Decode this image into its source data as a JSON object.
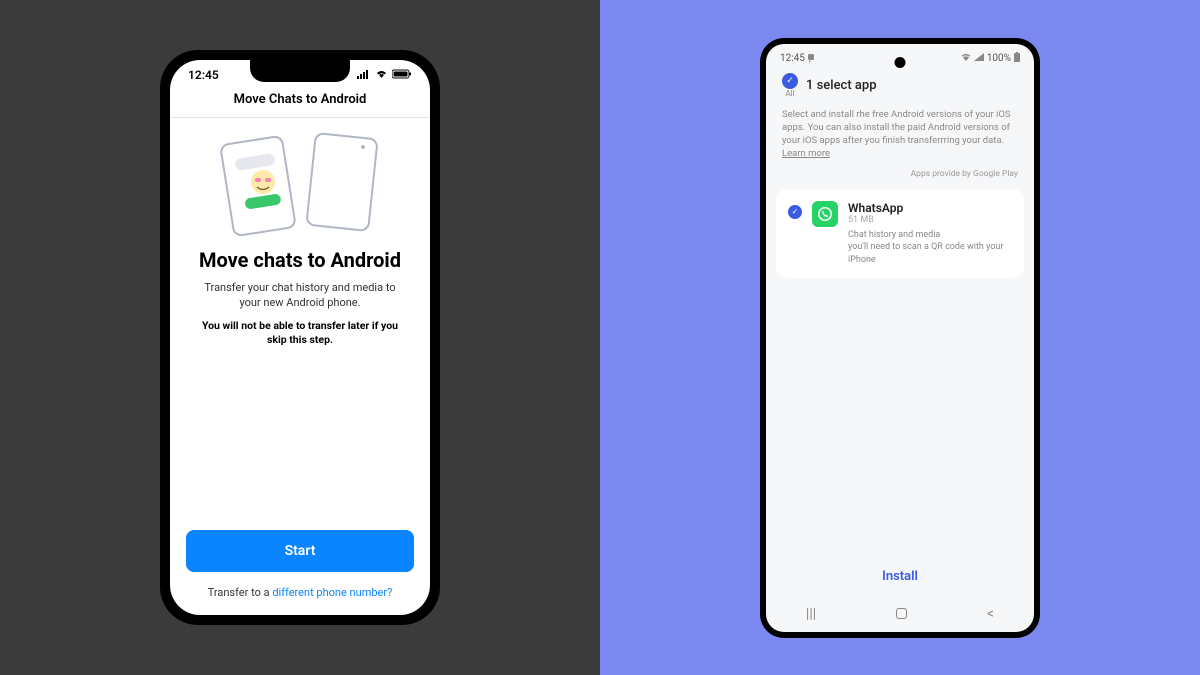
{
  "iphone": {
    "statusbar": {
      "time": "12:45"
    },
    "headerTitle": "Move Chats to Android",
    "mainTitle": "Move chats to Android",
    "description": "Transfer your chat history and media to your new Android phone.",
    "warning": "You will not be able to transfer later if you skip this step.",
    "startButton": "Start",
    "transferPrefix": "Transfer to a ",
    "transferLink": "different phone number?"
  },
  "android": {
    "statusbar": {
      "time": "12:45",
      "battery": "100%"
    },
    "allLabel": "All",
    "selectAppTitle": "1 select app",
    "description": "Select and install rhe free Android versions of your iOS apps. You can also install the paid Android versions of your iOS apps after you finish transferrring your data.",
    "learnMore": "Learn more",
    "appsProvide": "Apps provide by Google Play",
    "app": {
      "name": "WhatsApp",
      "size": "51 MB",
      "details1": "Chat history and media",
      "details2": "you'll need to scan a QR code with your iPhone"
    },
    "installButton": "Install"
  }
}
